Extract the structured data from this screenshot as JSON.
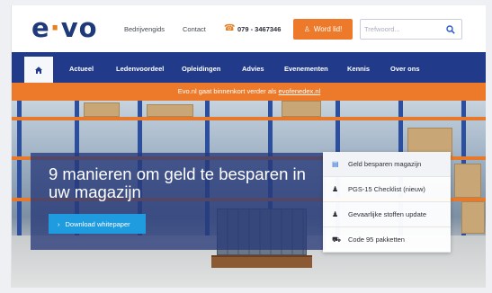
{
  "header": {
    "logo_text": "evo",
    "links": [
      "Bedrijvengids",
      "Contact"
    ],
    "phone": "079 - 3467346",
    "join_label": "Word lid!",
    "search_placeholder": "Trefwoord..."
  },
  "nav": {
    "items": [
      "Actueel",
      "Ledenvoordeel",
      "Opleidingen",
      "Advies",
      "Evenementen",
      "Kennis",
      "Over ons"
    ]
  },
  "notice": {
    "text": "Evo.nl gaat binnenkort verder als",
    "link": "evofenedex.nl"
  },
  "hero": {
    "title": "9 manieren om geld te besparen in uw magazijn",
    "button_label": "Download whitepaper"
  },
  "sidelist": {
    "items": [
      {
        "label": "Geld besparen magazijn",
        "icon": "building-icon"
      },
      {
        "label": "PGS-15 Checklist (nieuw)",
        "icon": "person-icon"
      },
      {
        "label": "Gevaarlijke stoffen update",
        "icon": "person-icon"
      },
      {
        "label": "Code 95 pakketten",
        "icon": "truck-icon"
      }
    ]
  },
  "colors": {
    "primary": "#213b8a",
    "accent": "#ec7a2a",
    "button_blue": "#1f9be0"
  }
}
